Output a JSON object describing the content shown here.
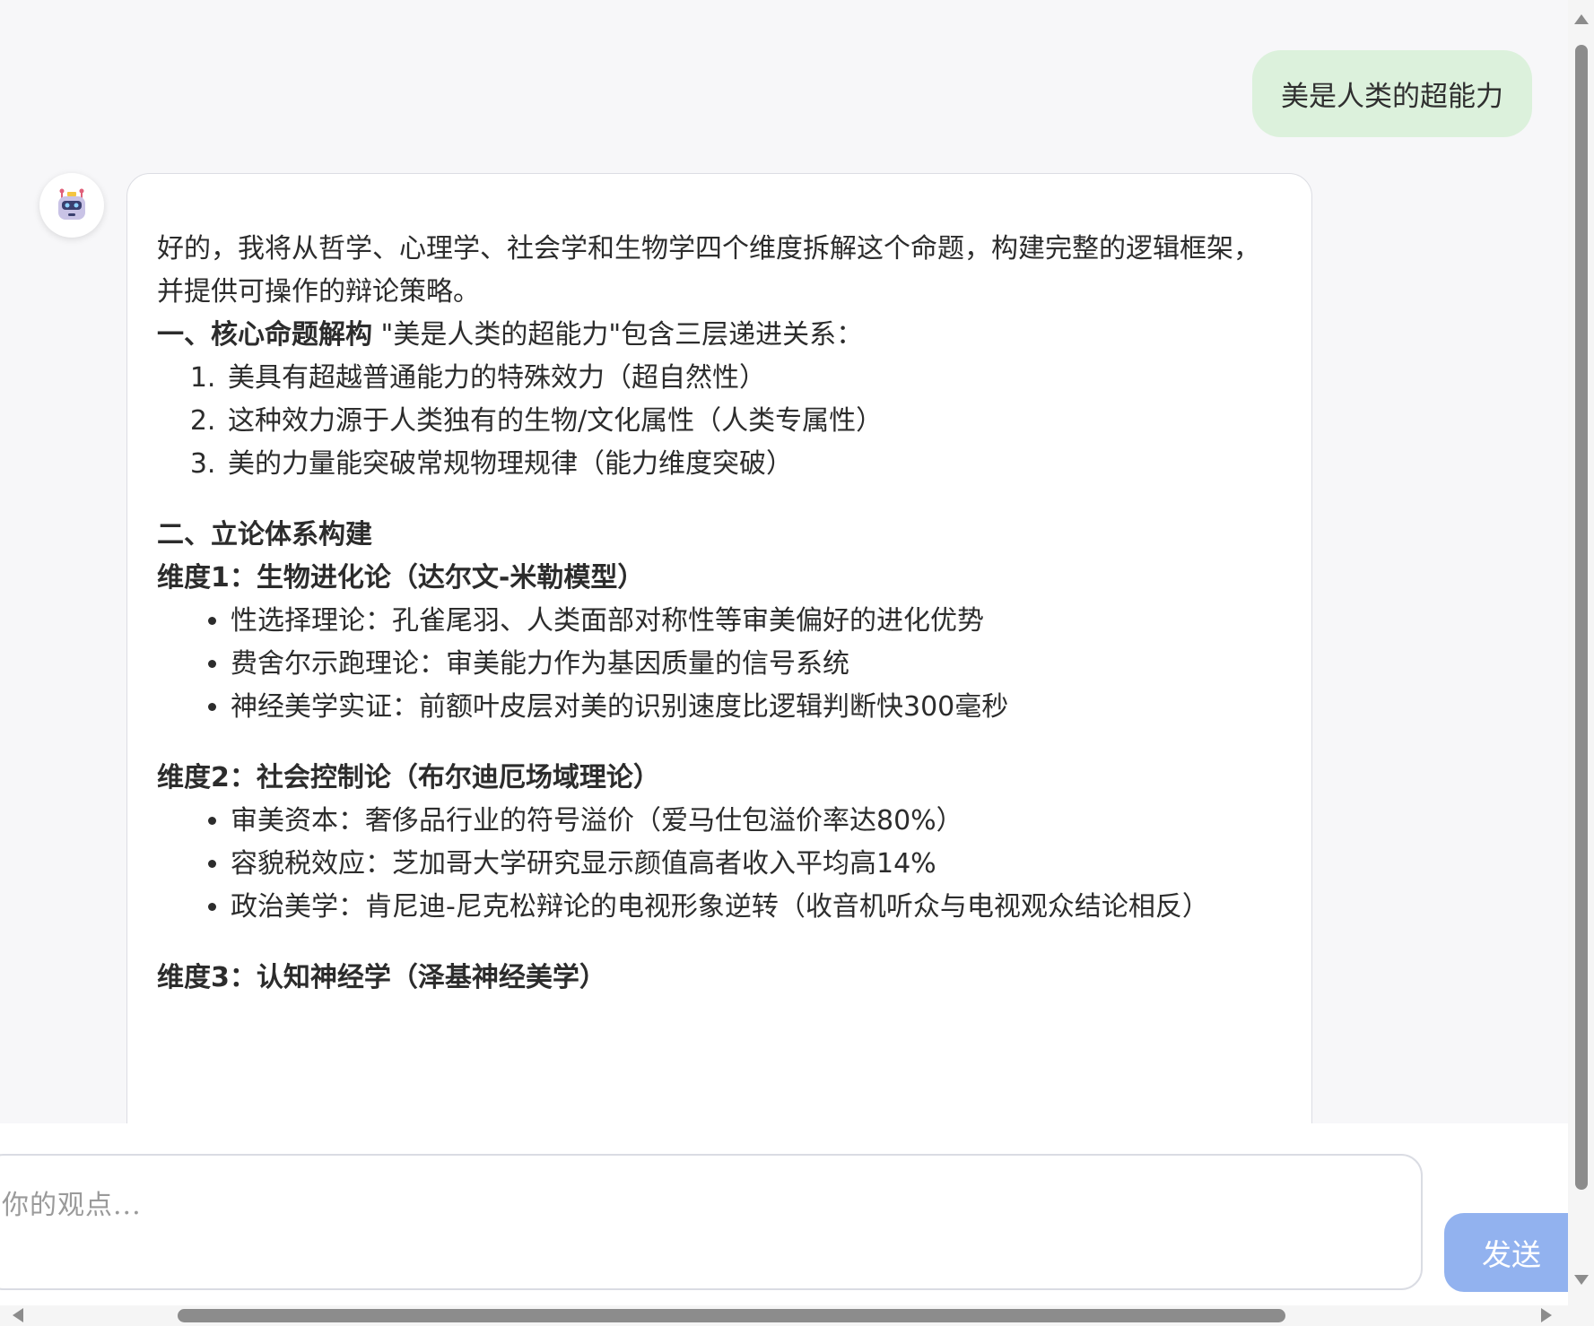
{
  "user_message": "美是人类的超能力",
  "assistant": {
    "avatar_icon": "robot-icon",
    "intro": "好的，我将从哲学、心理学、社会学和生物学四个维度拆解这个命题，构建完整的逻辑框架，并提供可操作的辩论策略。",
    "section1": {
      "title": "一、核心命题解构",
      "text": " \"美是人类的超能力\"包含三层递进关系：",
      "items": [
        "美具有超越普通能力的特殊效力（超自然性）",
        "这种效力源于人类独有的生物/文化属性（人类专属性）",
        "美的力量能突破常规物理规律（能力维度突破）"
      ]
    },
    "section2": {
      "title": "二、立论体系构建",
      "dim1": {
        "title": "维度1：生物进化论（达尔文-米勒模型）",
        "items": [
          "性选择理论：孔雀尾羽、人类面部对称性等审美偏好的进化优势",
          "费舍尔示跑理论：审美能力作为基因质量的信号系统",
          "神经美学实证：前额叶皮层对美的识别速度比逻辑判断快300毫秒"
        ]
      },
      "dim2": {
        "title": "维度2：社会控制论（布尔迪厄场域理论）",
        "items": [
          "审美资本：奢侈品行业的符号溢价（爱马仕包溢价率达80%）",
          "容貌税效应：芝加哥大学研究显示颜值高者收入平均高14%",
          "政治美学：肯尼迪-尼克松辩论的电视形象逆转（收音机听众与电视观众结论相反）"
        ]
      },
      "dim3": {
        "title": "维度3：认知神经学（泽基神经美学）"
      }
    }
  },
  "composer": {
    "placeholder": "你的观点...",
    "send_label": "发送"
  },
  "colors": {
    "user_bubble": "#dcf1dc",
    "send_button": "#92b2ef",
    "background": "#f7f7f9"
  }
}
